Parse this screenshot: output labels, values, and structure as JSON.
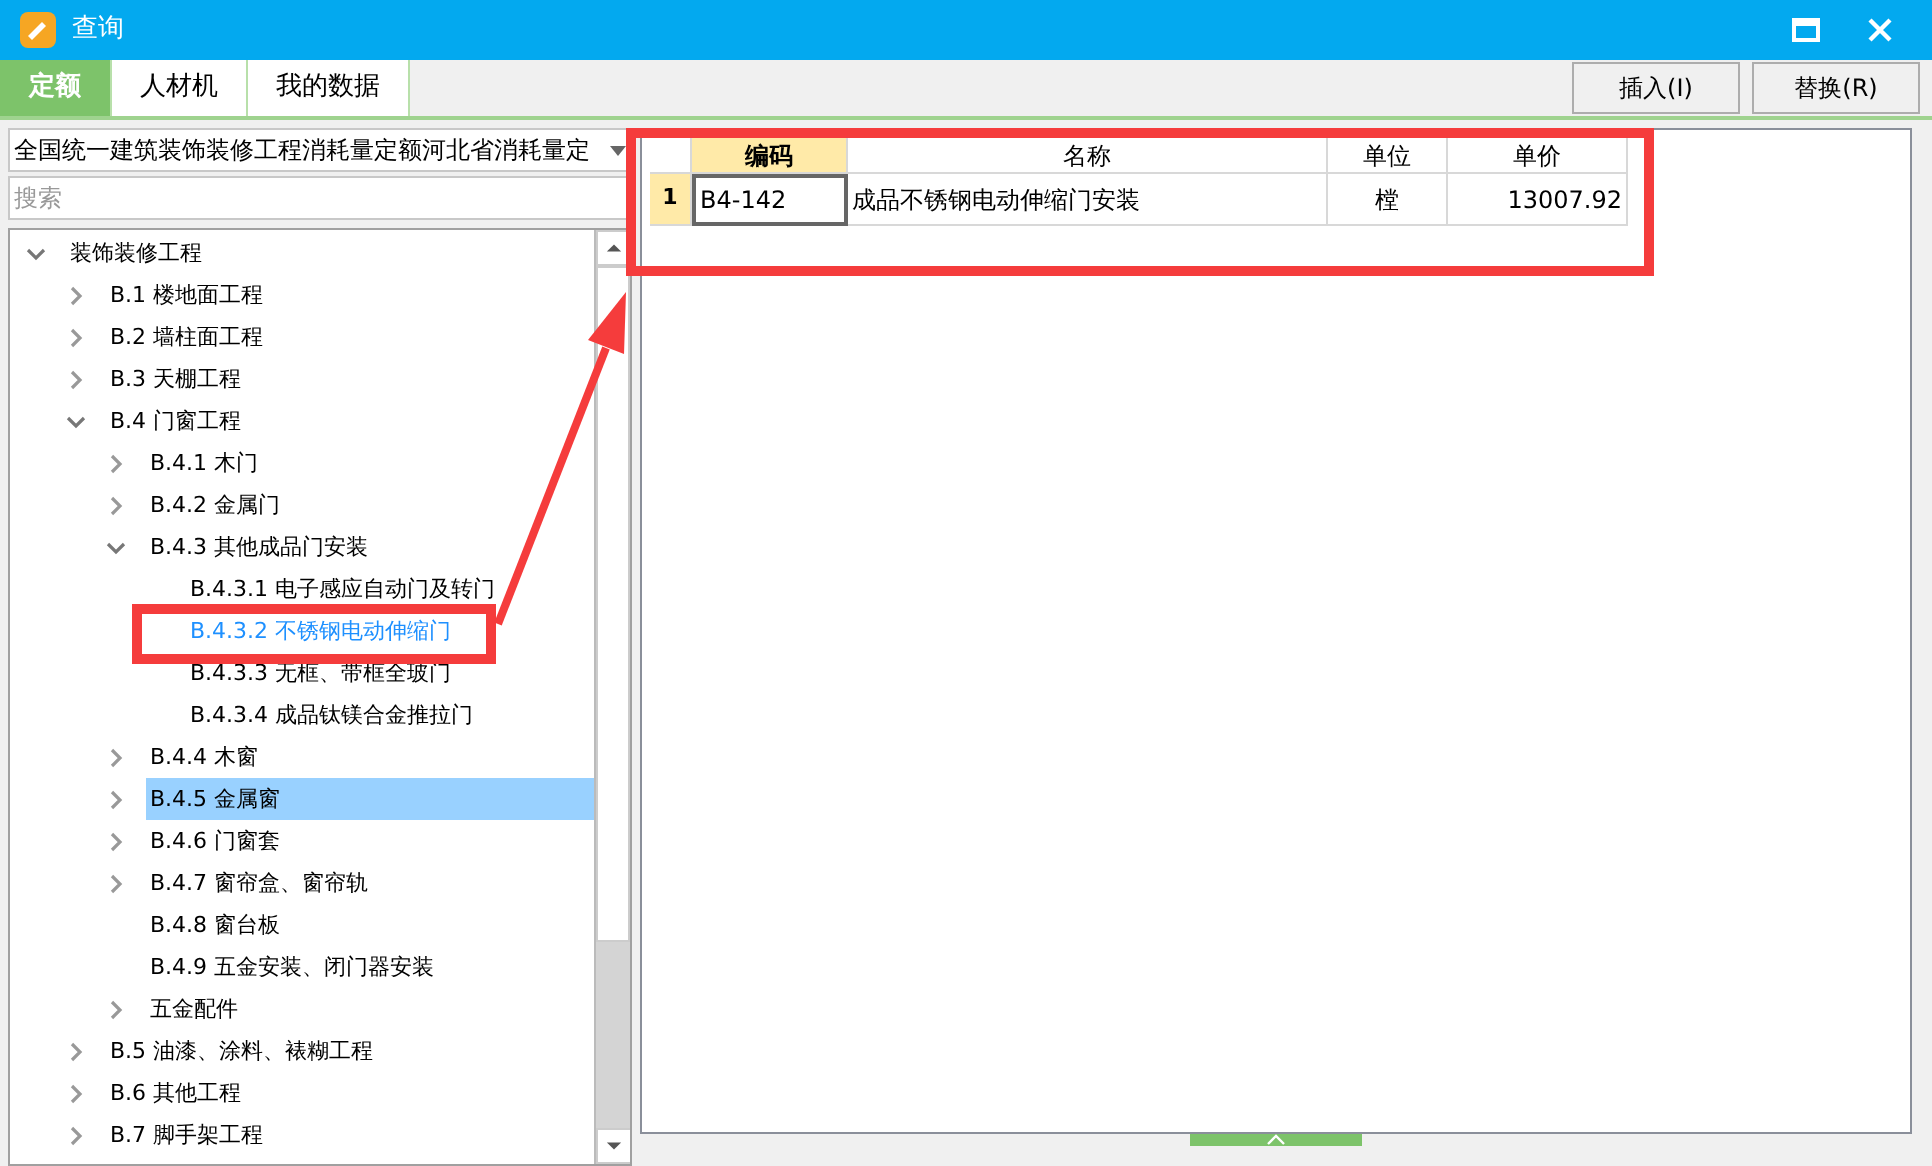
{
  "window": {
    "title": "查询"
  },
  "tabs": [
    {
      "label": "定额",
      "selected": true
    },
    {
      "label": "人材机",
      "selected": false
    },
    {
      "label": "我的数据",
      "selected": false
    }
  ],
  "buttons": [
    "插入(I)",
    "替换(R)"
  ],
  "library_select": {
    "value": "全国统一建筑装饰装修工程消耗量定额河北省消耗量定"
  },
  "search": {
    "placeholder": "搜索"
  },
  "tree": [
    {
      "label": "装饰装修工程",
      "expanded": true,
      "selected": false,
      "matched": false,
      "children": [
        {
          "label": "B.1 楼地面工程",
          "expanded": false,
          "selected": false,
          "matched": false
        },
        {
          "label": "B.2 墙柱面工程",
          "expanded": false,
          "selected": false,
          "matched": false
        },
        {
          "label": "B.3 天棚工程",
          "expanded": false,
          "selected": false,
          "matched": false
        },
        {
          "label": "B.4 门窗工程",
          "expanded": true,
          "selected": false,
          "matched": false,
          "children": [
            {
              "label": "B.4.1 木门",
              "expanded": false,
              "selected": false,
              "matched": false
            },
            {
              "label": "B.4.2 金属门",
              "expanded": false,
              "selected": false,
              "matched": false
            },
            {
              "label": "B.4.3 其他成品门安装",
              "expanded": true,
              "selected": false,
              "matched": false,
              "children": [
                {
                  "label": "B.4.3.1 电子感应自动门及转门",
                  "selected": false,
                  "matched": false
                },
                {
                  "label": "B.4.3.2 不锈钢电动伸缩门",
                  "selected": false,
                  "matched": true
                },
                {
                  "label": "B.4.3.3 无框、带框全玻门",
                  "selected": false,
                  "matched": false
                },
                {
                  "label": "B.4.3.4 成品钛镁合金推拉门",
                  "selected": false,
                  "matched": false
                }
              ]
            },
            {
              "label": "B.4.4 木窗",
              "expanded": false,
              "selected": false,
              "matched": false
            },
            {
              "label": "B.4.5 金属窗",
              "expanded": false,
              "selected": true,
              "matched": false
            },
            {
              "label": "B.4.6 门窗套",
              "expanded": false,
              "selected": false,
              "matched": false
            },
            {
              "label": "B.4.7 窗帘盒、窗帘轨",
              "expanded": false,
              "selected": false,
              "matched": false
            },
            {
              "label": "B.4.8 窗台板",
              "selected": false,
              "matched": false
            },
            {
              "label": "B.4.9 五金安装、闭门器安装",
              "selected": false,
              "matched": false
            },
            {
              "label": "五金配件",
              "expanded": false,
              "selected": false,
              "matched": false
            }
          ]
        },
        {
          "label": "B.5 油漆、涂料、裱糊工程",
          "expanded": false,
          "selected": false,
          "matched": false
        },
        {
          "label": "B.6 其他工程",
          "expanded": false,
          "selected": false,
          "matched": false
        },
        {
          "label": "B.7 脚手架工程",
          "expanded": false,
          "selected": false,
          "matched": false
        }
      ]
    }
  ],
  "table": {
    "columns": [
      {
        "label": "编码",
        "selected": true
      },
      {
        "label": "名称",
        "selected": false
      },
      {
        "label": "单位",
        "selected": false
      },
      {
        "label": "单价",
        "selected": false
      }
    ],
    "rows": [
      {
        "number": "1",
        "selected": true,
        "cells": [
          "B4-142",
          "成品不锈钢电动伸缩门安装",
          "樘",
          "13007.92"
        ]
      }
    ]
  }
}
